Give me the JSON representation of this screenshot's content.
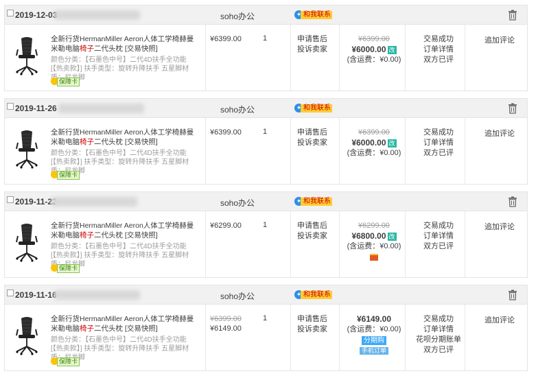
{
  "orders": [
    {
      "date": "2019-12-03",
      "shop": "soho办公",
      "contact": "和我联系",
      "title_prefix": "全新行货HermanMiller Aeron人体工学椅赫曼米勒电脑",
      "title_red": "椅子",
      "title_suffix": "二代头枕 [交易快照]",
      "attrs": "颜色分类：【石墨色中号】二代4D扶手全功能[【热卖款】] 扶手类型：旋转升降扶手  五星脚材质：尼龙脚",
      "card": "保障卡",
      "unit_price": "¥6399.00",
      "unit_price_old": "",
      "qty": "1",
      "after1": "申请售后",
      "after2": "投诉卖家",
      "old_total": "¥6399.00",
      "total": "¥6000.00",
      "total_badge": "改",
      "shipping": "(含运费：¥0.00)",
      "pay_badge1": "",
      "pay_badge2": "",
      "status": [
        "交易成功",
        "订单详情",
        "双方已评"
      ],
      "review": "追加评论"
    },
    {
      "date": "2019-11-26",
      "shop": "soho办公",
      "contact": "和我联系",
      "title_prefix": "全新行货HermanMiller Aeron人体工学椅赫曼米勒电脑",
      "title_red": "椅子",
      "title_suffix": "二代头枕 [交易快照]",
      "attrs": "颜色分类：【石墨色中号】二代4D扶手全功能[【热卖款】] 扶手类型：旋转升降扶手  五星脚材质：尼龙脚",
      "card": "保障卡",
      "unit_price": "¥6399.00",
      "unit_price_old": "",
      "qty": "1",
      "after1": "申请售后",
      "after2": "投诉卖家",
      "old_total": "¥6399.00",
      "total": "¥6000.00",
      "total_badge": "改",
      "shipping": "(含运费：¥0.00)",
      "pay_badge1": "",
      "pay_badge2": "",
      "status": [
        "交易成功",
        "订单详情",
        "双方已评"
      ],
      "review": "追加评论"
    },
    {
      "date": "2019-11-22",
      "shop": "soho办公",
      "contact": "和我联系",
      "title_prefix": "全新行货HermanMiller Aeron人体工学椅赫曼米勒电脑",
      "title_red": "椅子",
      "title_suffix": "二代头枕 [交易快照]",
      "attrs": "颜色分类：【石墨色中号】二代4D扶手全功能[【热卖款】] 扶手类型：旋转升降扶手  五星脚材质：尼龙脚",
      "card": "保障卡",
      "unit_price": "¥6299.00",
      "unit_price_old": "",
      "qty": "1",
      "after1": "申请售后",
      "after2": "投诉卖家",
      "old_total": "¥6299.00",
      "total": "¥6800.00",
      "total_badge": "改",
      "shipping": "(含运费：¥0.00)",
      "pay_badge1": "",
      "pay_badge2": "",
      "status": [
        "交易成功",
        "订单详情",
        "双方已评"
      ],
      "review": "追加评论"
    },
    {
      "date": "2019-11-16",
      "shop": "soho办公",
      "contact": "和我联系",
      "title_prefix": "全新行货HermanMiller Aeron人体工学椅赫曼米勒电脑",
      "title_red": "椅子",
      "title_suffix": "二代头枕 [交易快照]",
      "attrs": "颜色分类：【石墨色中号】二代4D扶手全功能[【热卖款】] 扶手类型：旋转升降扶手  五星脚材质：尼龙脚",
      "card": "保障卡",
      "unit_price": "¥6149.00",
      "unit_price_old": "¥6399.00",
      "qty": "1",
      "after1": "申请售后",
      "after2": "投诉卖家",
      "old_total": "",
      "total": "¥6149.00",
      "total_badge": "",
      "shipping": "(含运费：¥0.00)",
      "pay_badge1": "分期购",
      "pay_badge2": "手机订单",
      "status": [
        "交易成功",
        "订单详情",
        "花呗分期账单",
        "双方已评"
      ],
      "review": "追加评论"
    }
  ]
}
